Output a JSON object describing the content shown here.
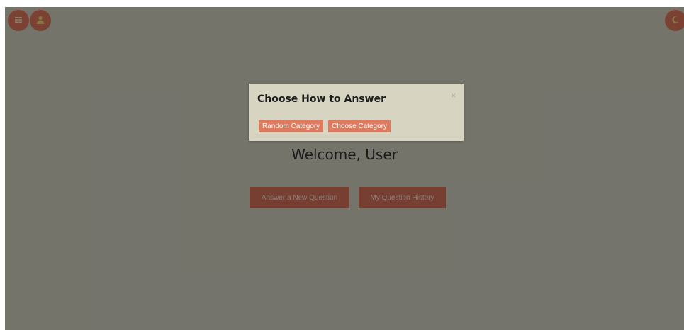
{
  "header": {
    "menu_icon": "menu-icon",
    "profile_icon": "user-icon",
    "theme_icon": "moon-icon"
  },
  "main": {
    "welcome_text": "Welcome, User",
    "answer_button": "Answer a New Question",
    "history_button": "My Question History"
  },
  "modal": {
    "title": "Choose How to Answer",
    "close_label": "×",
    "random_button": "Random Category",
    "choose_button": "Choose Category"
  },
  "colors": {
    "page_background": "#d6d3c4",
    "accent": "#e07a5f",
    "overlay": "rgba(0,0,0,0.45)"
  }
}
